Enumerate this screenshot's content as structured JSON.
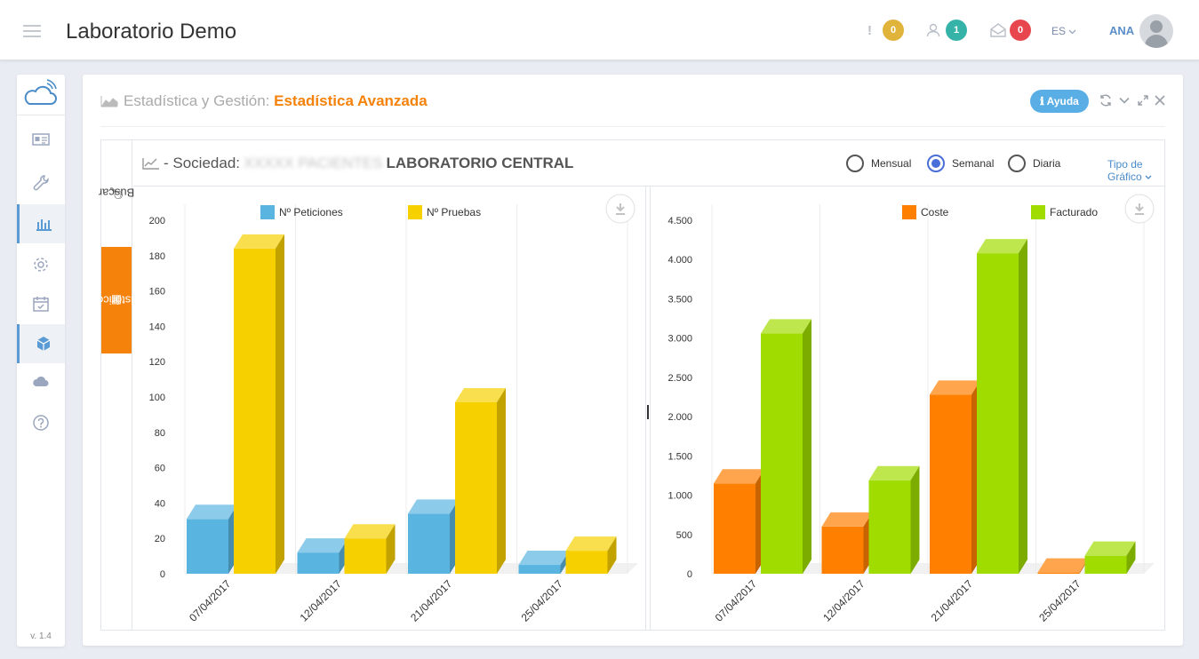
{
  "header": {
    "title": "Laboratorio Demo",
    "alerts_count": "0",
    "users_count": "1",
    "messages_count": "0",
    "language": "ES",
    "user": "ANA",
    "colors": {
      "alerts": "#e0b33a",
      "users": "#36b3a8",
      "messages": "#e8464e"
    }
  },
  "sidebar": {
    "items": [
      {
        "icon": "id-card-icon"
      },
      {
        "icon": "wrench-icon"
      },
      {
        "icon": "bar-chart-icon",
        "active": true
      },
      {
        "icon": "gear-icon"
      },
      {
        "icon": "calendar-check-icon"
      },
      {
        "icon": "cube-icon",
        "active": true
      },
      {
        "icon": "cloud-icon"
      },
      {
        "icon": "help-icon"
      }
    ],
    "version": "v. 1.4"
  },
  "panel": {
    "breadcrumb_prefix": "Estadística y Gestión:",
    "breadcrumb_current": "Estadística Avanzada",
    "help_label": "Ayuda"
  },
  "tabs": {
    "buscar": "Buscar",
    "historicos": "Históricos"
  },
  "chart_header": {
    "prefix": "- Sociedad:",
    "blurred_name": "XXXXX PACIENTES",
    "lab_name": "LABORATORIO CENTRAL",
    "options": [
      "Mensual",
      "Semanal",
      "Diaria"
    ],
    "selected": "Semanal",
    "chart_type_label": "Tipo de Gráfico"
  },
  "chart_data": [
    {
      "type": "bar",
      "categories": [
        "07/04/2017",
        "12/04/2017",
        "21/04/2017",
        "25/04/2017"
      ],
      "series": [
        {
          "name": "Nº Peticiones",
          "values": [
            31,
            12,
            34,
            5
          ],
          "color": "#5ab4e0"
        },
        {
          "name": "Nº Pruebas",
          "values": [
            184,
            20,
            97,
            13
          ],
          "color": "#f7d000"
        }
      ],
      "ylim": [
        0,
        200
      ],
      "yticks": [
        "0",
        "20",
        "40",
        "60",
        "80",
        "100",
        "120",
        "140",
        "160",
        "180",
        "200"
      ],
      "legend": "top-center",
      "three_d": true
    },
    {
      "type": "bar",
      "categories": [
        "07/04/2017",
        "12/04/2017",
        "21/04/2017",
        "25/04/2017"
      ],
      "series": [
        {
          "name": "Coste",
          "values": [
            1150,
            600,
            2280,
            15
          ],
          "color": "#ff7f00"
        },
        {
          "name": "Facturado",
          "values": [
            3060,
            1190,
            4080,
            230
          ],
          "color": "#a0dc00"
        }
      ],
      "ylim": [
        0,
        4500
      ],
      "yticks": [
        "0",
        "500",
        "1.000",
        "1.500",
        "2.000",
        "2.500",
        "3.000",
        "3.500",
        "4.000",
        "4.500"
      ],
      "legend": "top-center",
      "three_d": true
    }
  ]
}
